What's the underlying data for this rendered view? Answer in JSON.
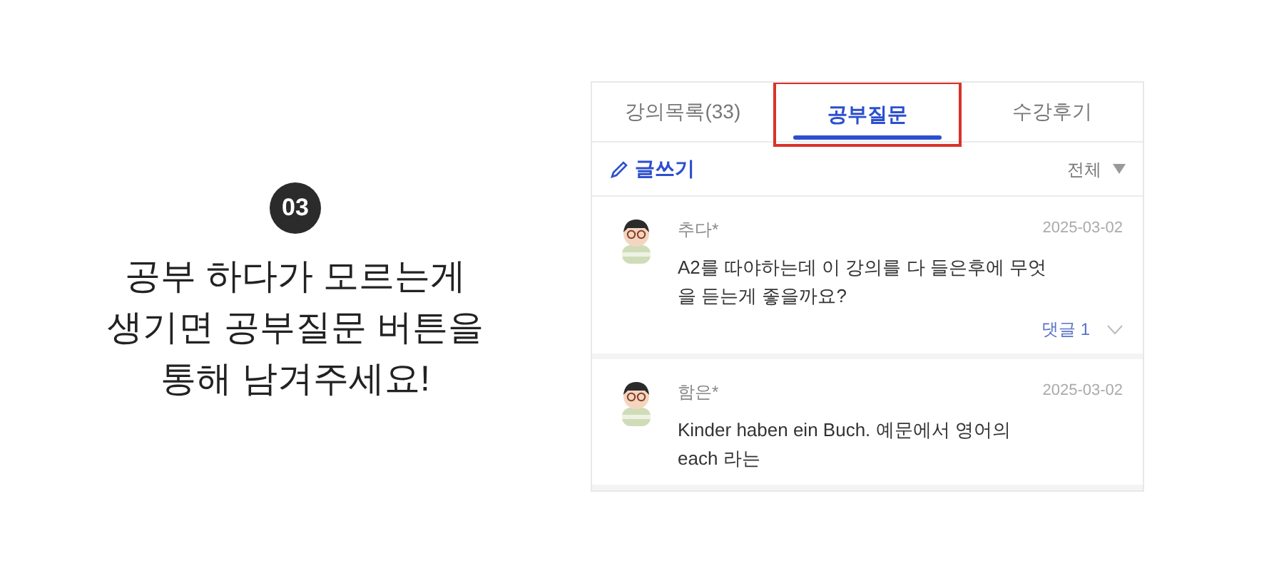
{
  "step": {
    "badge": "03",
    "caption_lines": [
      "공부 하다가 모르는게",
      "생기면 공부질문 버튼을",
      "통해 남겨주세요!"
    ]
  },
  "tabs": [
    {
      "label": "강의목록(33)",
      "selected": false,
      "highlighted": false
    },
    {
      "label": "공부질문",
      "selected": true,
      "highlighted": true
    },
    {
      "label": "수강후기",
      "selected": false,
      "highlighted": false
    }
  ],
  "toolbar": {
    "write_label": "글쓰기",
    "filter": "전체"
  },
  "posts": [
    {
      "author": "추다*",
      "date": "2025-03-02",
      "body": "A2를 따야하는데 이 강의를 다 들은후에 무엇을 듣는게 좋을까요?",
      "comments": "댓글 1"
    },
    {
      "author": "함은*",
      "date": "2025-03-02",
      "body": "Kinder haben ein Buch. 예문에서 영어의 each 라는"
    }
  ]
}
